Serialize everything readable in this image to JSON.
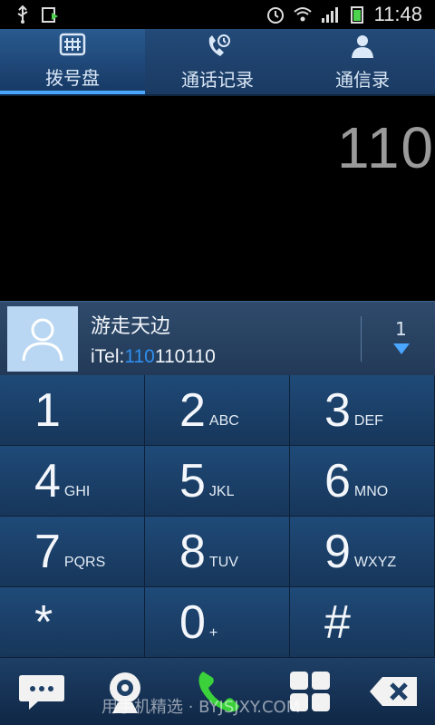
{
  "status_bar": {
    "time": "11:48",
    "left_icons": [
      "usb-icon",
      "battery-charging-icon"
    ],
    "right_icons": [
      "alarm-icon",
      "wifi-icon",
      "signal-icon",
      "battery-icon"
    ]
  },
  "tabs": [
    {
      "label": "拨号盘",
      "icon": "keypad-icon",
      "active": true
    },
    {
      "label": "通话记录",
      "icon": "call-log-icon",
      "active": false
    },
    {
      "label": "通信录",
      "icon": "contacts-icon",
      "active": false
    }
  ],
  "dialer": {
    "number": "110"
  },
  "suggestion": {
    "name": "游走天边",
    "tel_prefix": "iTel:",
    "tel_match": "110",
    "tel_rest": "110110",
    "count": "1"
  },
  "keys": [
    {
      "digit": "1",
      "letters": ""
    },
    {
      "digit": "2",
      "letters": "ABC"
    },
    {
      "digit": "3",
      "letters": "DEF"
    },
    {
      "digit": "4",
      "letters": "GHI"
    },
    {
      "digit": "5",
      "letters": "JKL"
    },
    {
      "digit": "6",
      "letters": "MNO"
    },
    {
      "digit": "7",
      "letters": "PQRS"
    },
    {
      "digit": "8",
      "letters": "TUV"
    },
    {
      "digit": "9",
      "letters": "WXYZ"
    },
    {
      "digit": "*",
      "letters": ""
    },
    {
      "digit": "0",
      "letters": "+"
    },
    {
      "digit": "#",
      "letters": ""
    }
  ],
  "bottom_bar": [
    "message-icon",
    "video-call-icon",
    "call-icon",
    "menu-grid-icon",
    "backspace-icon"
  ],
  "watermark": "用手机精选 · BYJSJXY.COM",
  "colors": {
    "accent": "#4aa6ff",
    "call_green": "#3ad13a",
    "key_bg": "#1f4a78"
  }
}
